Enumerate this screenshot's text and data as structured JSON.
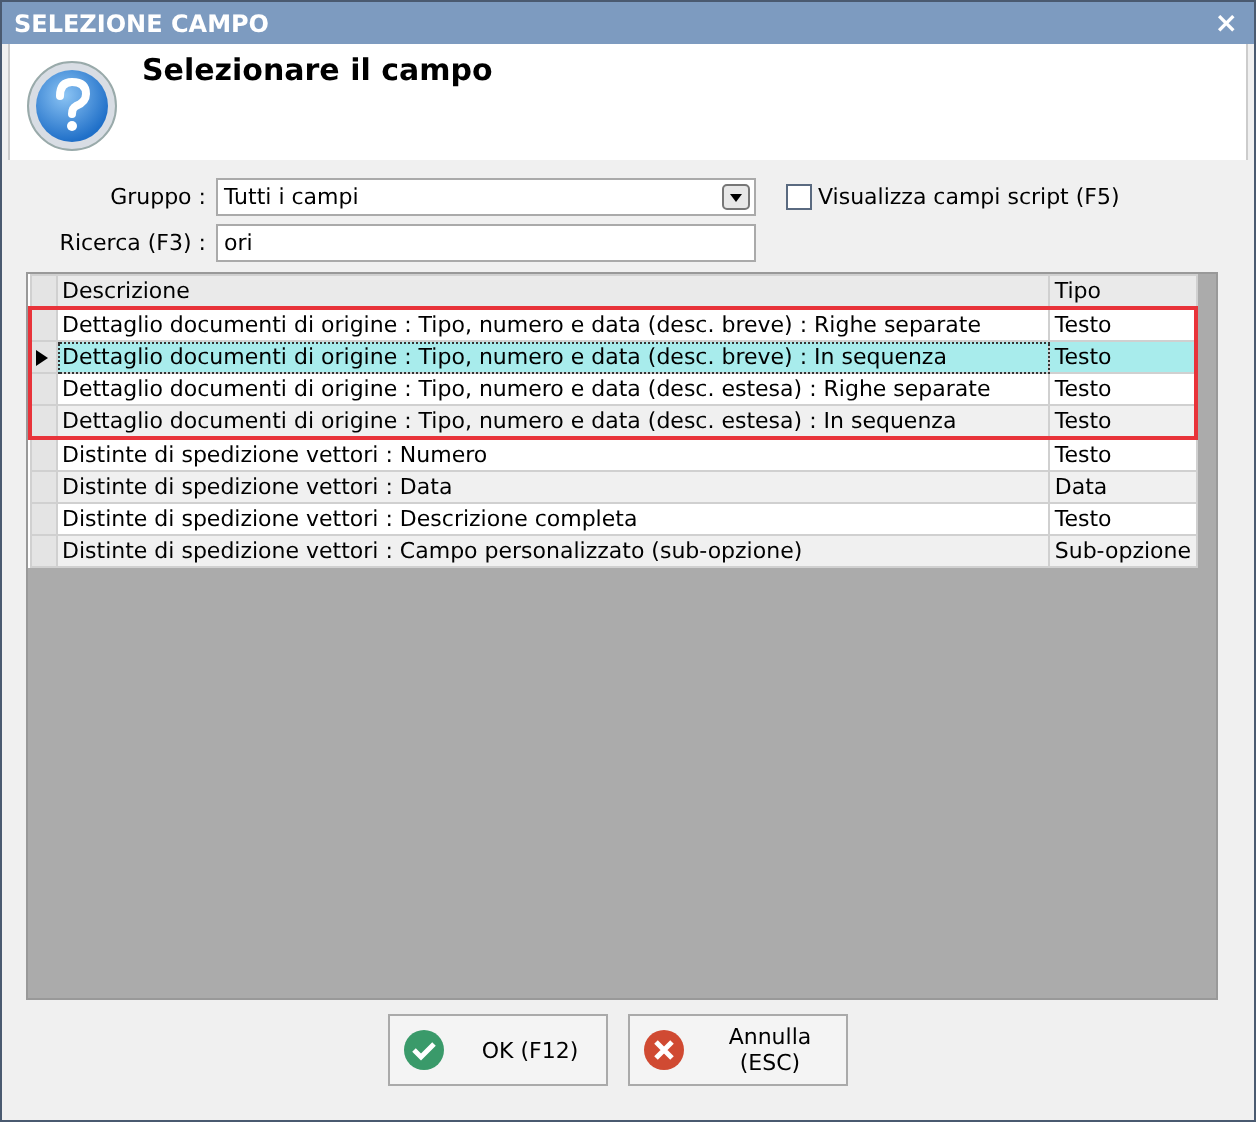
{
  "window": {
    "title": "SELEZIONE CAMPO",
    "close": "×"
  },
  "header": {
    "title": "Selezionare il campo"
  },
  "form": {
    "group_label": "Gruppo :",
    "group_value": "Tutti i campi",
    "script_checkbox": {
      "label": "Visualizza campi script (F5)",
      "checked": false
    },
    "search_label": "Ricerca (F3) :",
    "search_value": "ori"
  },
  "table": {
    "columns": [
      "Descrizione",
      "Tipo"
    ],
    "rows": [
      {
        "cells": [
          "Dettaglio documenti di origine : Tipo, numero e data (desc. breve) : Righe separate",
          "Testo"
        ],
        "selected": false,
        "highlighted": true
      },
      {
        "cells": [
          "Dettaglio documenti di origine : Tipo, numero e data (desc. breve) : In sequenza",
          "Testo"
        ],
        "selected": true,
        "highlighted": true
      },
      {
        "cells": [
          "Dettaglio documenti di origine : Tipo, numero e data (desc. estesa) : Righe separate",
          "Testo"
        ],
        "selected": false,
        "highlighted": true
      },
      {
        "cells": [
          "Dettaglio documenti di origine : Tipo, numero e data (desc. estesa) : In sequenza",
          "Testo"
        ],
        "selected": false,
        "highlighted": true
      },
      {
        "cells": [
          "Distinte di spedizione vettori : Numero",
          "Testo"
        ],
        "selected": false,
        "highlighted": false
      },
      {
        "cells": [
          "Distinte di spedizione vettori : Data",
          "Data"
        ],
        "selected": false,
        "highlighted": false
      },
      {
        "cells": [
          "Distinte di spedizione vettori : Descrizione completa",
          "Testo"
        ],
        "selected": false,
        "highlighted": false
      },
      {
        "cells": [
          "Distinte di spedizione vettori : Campo personalizzato (sub-opzione)",
          "Sub-opzione"
        ],
        "selected": false,
        "highlighted": false
      }
    ]
  },
  "buttons": [
    {
      "kind": "ok",
      "label": "OK (F12)"
    },
    {
      "kind": "cancel",
      "label": "Annulla (ESC)"
    }
  ]
}
